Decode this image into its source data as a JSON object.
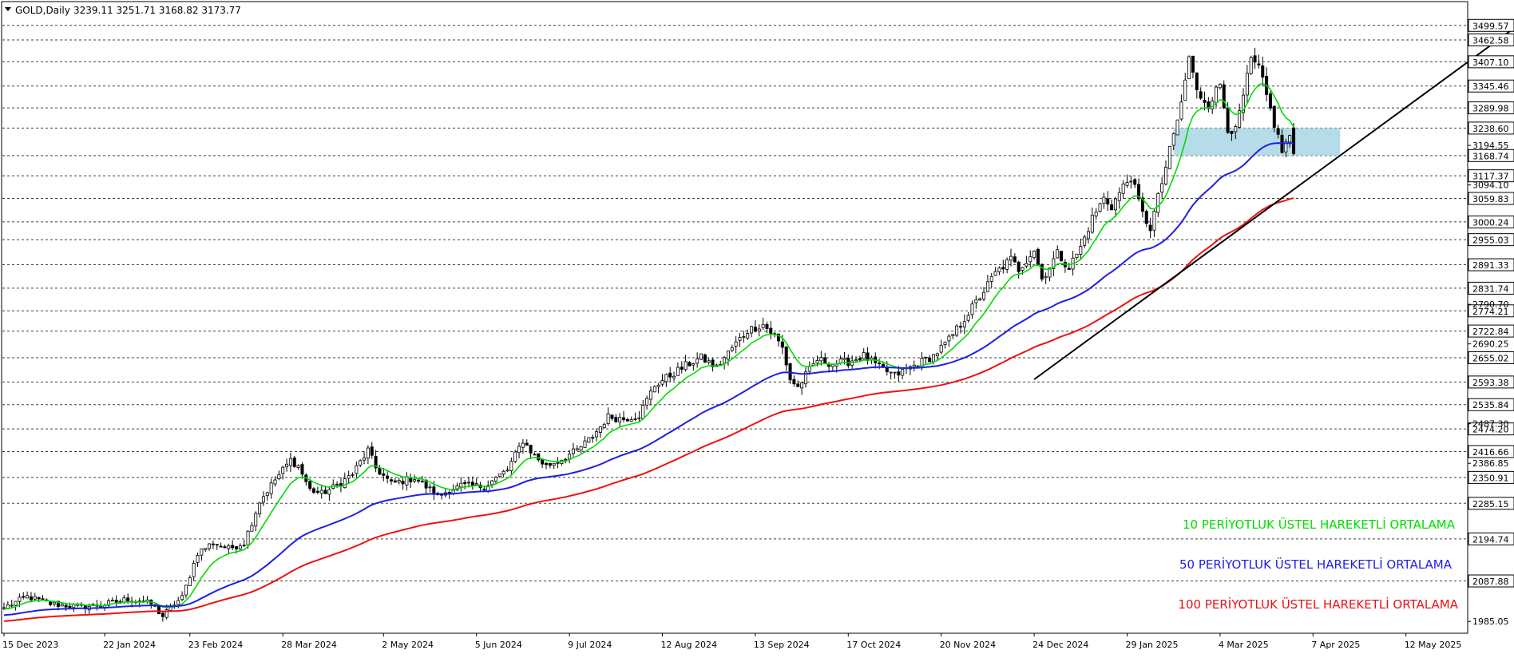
{
  "header": {
    "symbol": "GOLD,Daily",
    "ohlc": "3239.11 3251.71 3168.82 3173.77"
  },
  "chart_data": {
    "type": "candlestick",
    "symbol": "GOLD",
    "timeframe": "Daily",
    "ohlc_last": {
      "open": 3239.11,
      "high": 3251.71,
      "low": 3168.82,
      "close": 3173.77
    },
    "ylim": [
      1955,
      3560
    ],
    "grid": false,
    "x_tick_labels": [
      "15 Dec 2023",
      "22 Jan 2024",
      "23 Feb 2024",
      "28 Mar 2024",
      "2 May 2024",
      "5 Jun 2024",
      "9 Jul 2024",
      "12 Aug 2024",
      "13 Sep 2024",
      "17 Oct 2024",
      "20 Nov 2024",
      "24 Dec 2024",
      "29 Jan 2025",
      "4 Mar 2025",
      "7 Apr 2025",
      "12 May 2025"
    ],
    "x_tick_index": [
      0,
      26,
      48,
      72,
      98,
      122,
      146,
      170,
      194,
      218,
      242,
      266,
      290,
      314,
      338,
      362
    ],
    "price_levels": [
      3499.57,
      3462.58,
      3407.1,
      3345.46,
      3289.98,
      3238.6,
      3168.74,
      3117.37,
      3059.83,
      3000.24,
      2955.03,
      2891.33,
      2831.74,
      2774.21,
      2722.84,
      2655.02,
      2593.38,
      2535.84,
      2474.2,
      2416.66,
      2350.91,
      2285.15,
      2194.74,
      2087.88
    ],
    "axis_plain_labels": [
      3194.55,
      3094.1,
      2790.7,
      2690.25,
      2487.3,
      2386.85,
      1985.05
    ],
    "close_anchors": [
      [
        0,
        2020
      ],
      [
        6,
        2048
      ],
      [
        12,
        2030
      ],
      [
        20,
        2022
      ],
      [
        26,
        2028
      ],
      [
        32,
        2042
      ],
      [
        38,
        2030
      ],
      [
        41,
        1998
      ],
      [
        44,
        2030
      ],
      [
        46,
        2045
      ],
      [
        50,
        2160
      ],
      [
        54,
        2185
      ],
      [
        58,
        2170
      ],
      [
        62,
        2185
      ],
      [
        66,
        2290
      ],
      [
        70,
        2345
      ],
      [
        74,
        2395
      ],
      [
        76,
        2380
      ],
      [
        79,
        2320
      ],
      [
        82,
        2310
      ],
      [
        86,
        2330
      ],
      [
        90,
        2360
      ],
      [
        94,
        2420
      ],
      [
        96,
        2375
      ],
      [
        100,
        2335
      ],
      [
        106,
        2350
      ],
      [
        112,
        2305
      ],
      [
        118,
        2330
      ],
      [
        124,
        2328
      ],
      [
        130,
        2370
      ],
      [
        134,
        2445
      ],
      [
        137,
        2405
      ],
      [
        140,
        2380
      ],
      [
        144,
        2398
      ],
      [
        148,
        2420
      ],
      [
        152,
        2455
      ],
      [
        156,
        2505
      ],
      [
        160,
        2500
      ],
      [
        164,
        2510
      ],
      [
        168,
        2585
      ],
      [
        172,
        2610
      ],
      [
        176,
        2635
      ],
      [
        180,
        2655
      ],
      [
        184,
        2630
      ],
      [
        188,
        2680
      ],
      [
        192,
        2725
      ],
      [
        196,
        2740
      ],
      [
        199,
        2710
      ],
      [
        201,
        2680
      ],
      [
        203,
        2600
      ],
      [
        205,
        2580
      ],
      [
        208,
        2625
      ],
      [
        210,
        2650
      ],
      [
        214,
        2640
      ],
      [
        218,
        2645
      ],
      [
        222,
        2660
      ],
      [
        226,
        2630
      ],
      [
        230,
        2610
      ],
      [
        232,
        2620
      ],
      [
        236,
        2640
      ],
      [
        240,
        2660
      ],
      [
        244,
        2700
      ],
      [
        248,
        2755
      ],
      [
        252,
        2810
      ],
      [
        256,
        2870
      ],
      [
        260,
        2905
      ],
      [
        262,
        2880
      ],
      [
        266,
        2930
      ],
      [
        268,
        2855
      ],
      [
        272,
        2920
      ],
      [
        275,
        2885
      ],
      [
        278,
        2935
      ],
      [
        281,
        3010
      ],
      [
        284,
        3060
      ],
      [
        286,
        3040
      ],
      [
        289,
        3090
      ],
      [
        291,
        3115
      ],
      [
        294,
        3020
      ],
      [
        296,
        2985
      ],
      [
        299,
        3100
      ],
      [
        302,
        3220
      ],
      [
        304,
        3300
      ],
      [
        306,
        3420
      ],
      [
        308,
        3330
      ],
      [
        311,
        3300
      ],
      [
        314,
        3350
      ],
      [
        316,
        3240
      ],
      [
        318,
        3230
      ],
      [
        320,
        3320
      ],
      [
        322,
        3410
      ],
      [
        324,
        3390
      ],
      [
        326,
        3320
      ],
      [
        328,
        3250
      ],
      [
        330,
        3180
      ],
      [
        332,
        3220
      ],
      [
        333,
        3173.77
      ]
    ],
    "series": [
      {
        "name": "10 PERİYOTLUK ÜSTEL HAREKETLİ ORTALAMA",
        "color": "#00dd00",
        "period": 10
      },
      {
        "name": "50 PERİYOTLUK ÜSTEL HAREKETLİ ORTALAMA",
        "color": "#1f1fe6",
        "period": 50
      },
      {
        "name": "100 PERİYOTLUK ÜSTEL HAREKETLİ ORTALAMA",
        "color": "#ee1111",
        "period": 100
      }
    ],
    "trendline": {
      "from": [
        266,
        2600
      ],
      "to": [
        400,
        3565
      ],
      "color": "#000000"
    },
    "zone": {
      "x_from": 302,
      "x_to": 345,
      "y_from": 3168.74,
      "y_to": 3238.6,
      "color": "#add8e6"
    }
  },
  "legend": {
    "ema10": "10 PERİYOTLUK ÜSTEL HAREKETLİ ORTALAMA",
    "ema50": "50 PERİYOTLUK ÜSTEL HAREKETLİ ORTALAMA",
    "ema100": "100 PERİYOTLUK ÜSTEL HAREKETLİ ORTALAMA"
  },
  "colors": {
    "ema10": "#00dd00",
    "ema50": "#1f1fe6",
    "ema100": "#ee1111",
    "zone": "#add8e6",
    "trendline": "#000000"
  }
}
